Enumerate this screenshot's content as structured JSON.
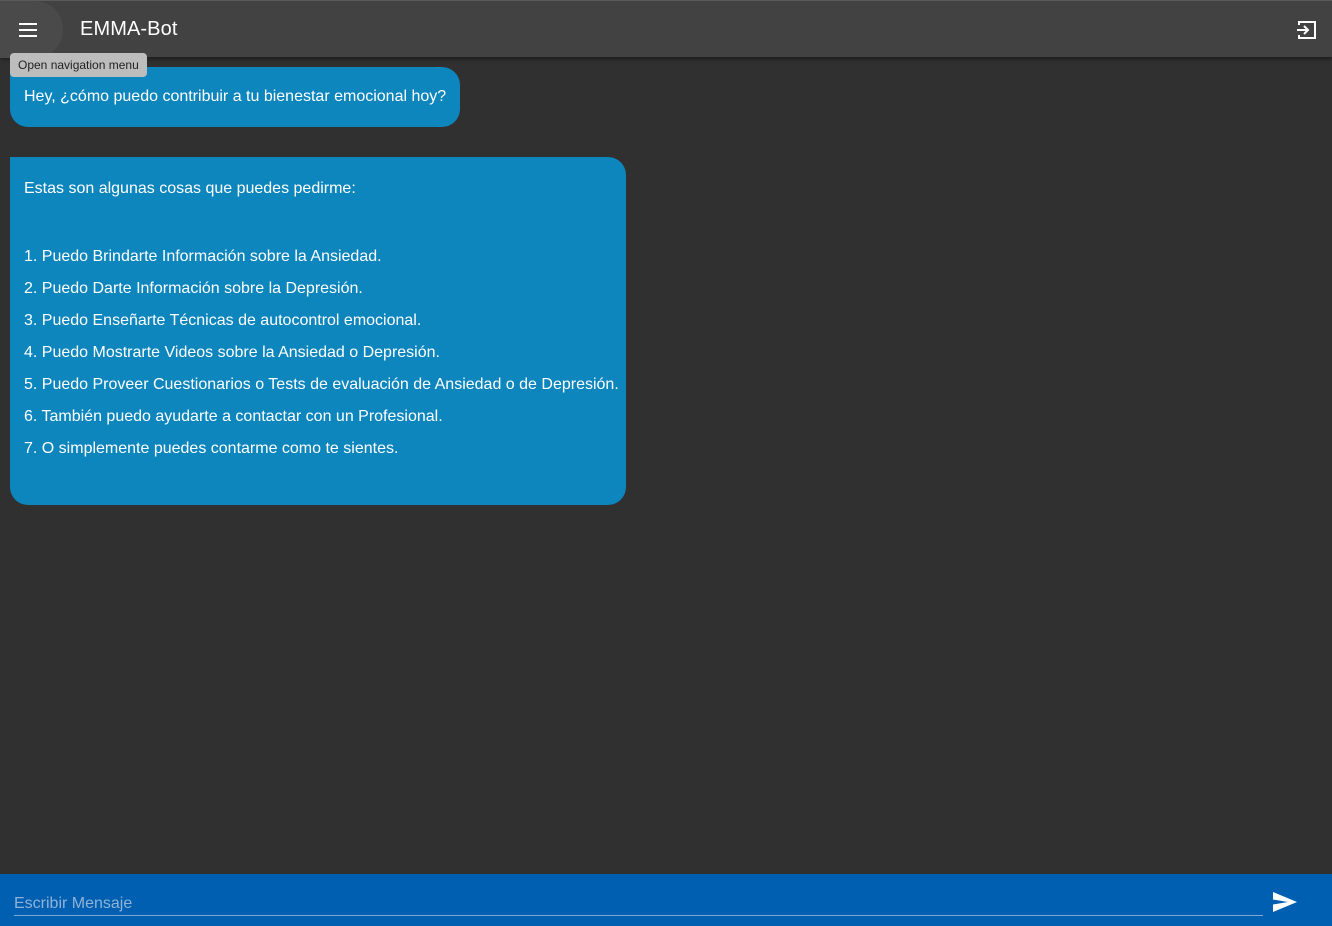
{
  "header": {
    "title": "EMMA-Bot",
    "menu_icon": "menu-icon",
    "logout_icon": "logout-icon"
  },
  "tooltip": {
    "text": "Open navigation menu"
  },
  "messages": [
    {
      "text": "Hey, ¿cómo puedo contribuir a tu bienestar emocional hoy?"
    },
    {
      "intro": "Estas son algunas cosas que puedes pedirme:",
      "items": [
        "1. Puedo Brindarte Información sobre la Ansiedad.",
        "2. Puedo Darte Información sobre la Depresión.",
        "3. Puedo Enseñarte Técnicas de autocontrol emocional.",
        "4. Puedo Mostrarte Videos sobre la Ansiedad o Depresión.",
        "5. Puedo Proveer Cuestionarios o Tests de evaluación de Ansiedad o de Depresión.",
        "6. También puedo ayudarte a contactar con un Profesional.",
        "7. O simplemente puedes contarme como te sientes."
      ]
    }
  ],
  "composer": {
    "placeholder": "Escribir Mensaje",
    "value": "",
    "send_icon": "send-icon"
  },
  "colors": {
    "background": "#303030",
    "appbar": "#424242",
    "bubble": "#0d85bd",
    "composer": "#005fb0"
  }
}
